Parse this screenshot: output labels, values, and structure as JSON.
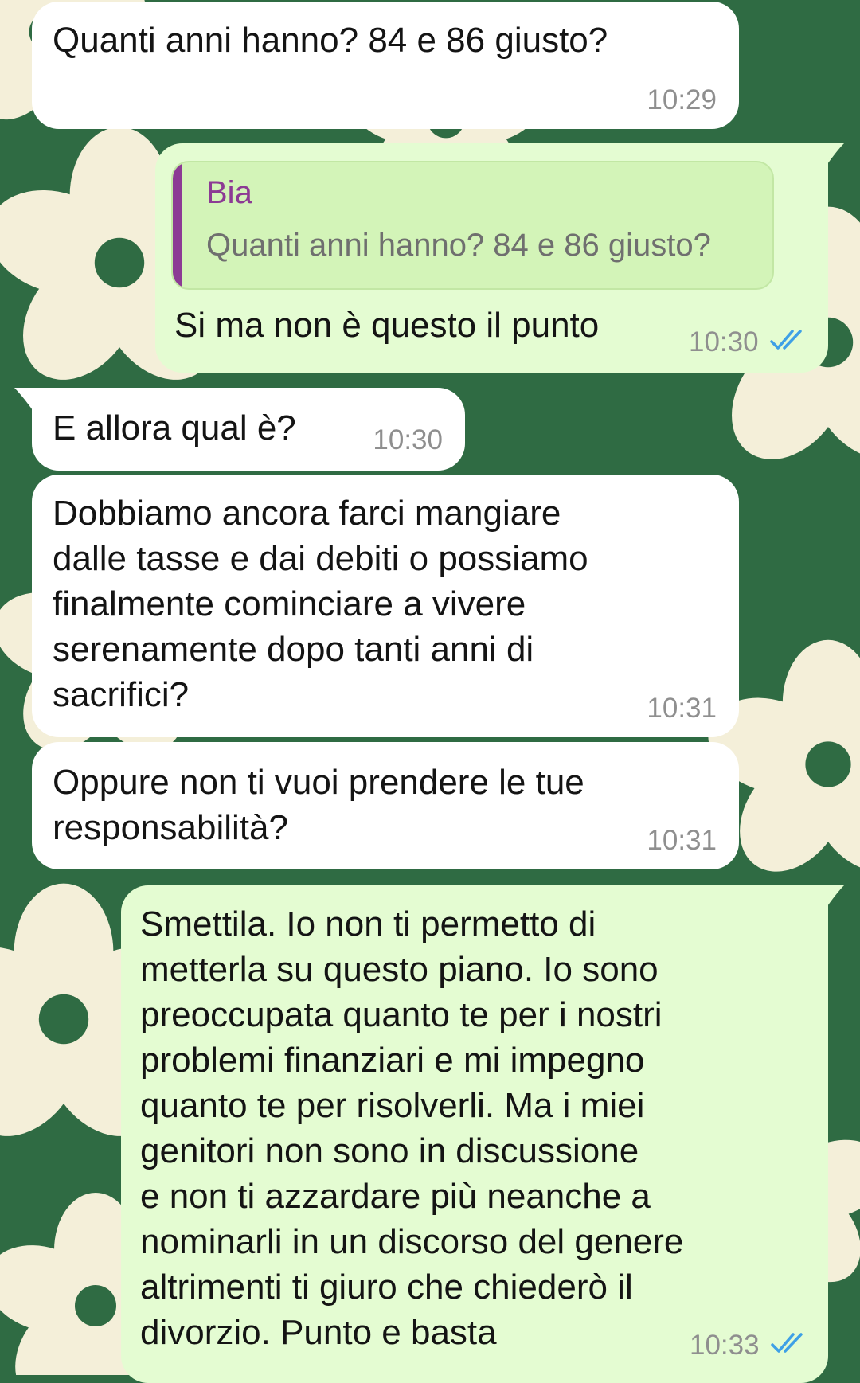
{
  "colors": {
    "wallpaper": "#2f6b43",
    "flower": "#f4efd9",
    "incoming_bubble": "#ffffff",
    "outgoing_bubble": "#e4fcd2",
    "quote_accent": "#8c3a94",
    "read_ticks": "#3ea0e6"
  },
  "icons": {
    "read_receipt": "double-check-icon"
  },
  "messages": [
    {
      "direction": "incoming",
      "text": "Quanti anni hanno? 84 e 86 giusto?",
      "time": "10:29"
    },
    {
      "direction": "outgoing",
      "reply": {
        "author": "Bia",
        "text": "Quanti anni hanno? 84 e 86 giusto?"
      },
      "text": "Si ma non è questo il punto",
      "time": "10:30",
      "status": "read"
    },
    {
      "direction": "incoming",
      "text": "E allora qual è?",
      "time": "10:30"
    },
    {
      "direction": "incoming",
      "text": "Dobbiamo ancora farci mangiare\ndalle tasse e dai debiti o possiamo\nfinalmente cominciare a vivere\nserenamente dopo tanti anni di\nsacrifici?",
      "time": "10:31"
    },
    {
      "direction": "incoming",
      "text": "Oppure non ti vuoi prendere le tue\nresponsabilità?",
      "time": "10:31"
    },
    {
      "direction": "outgoing",
      "text": "Smettila. Io non ti permetto di\nmetterla su questo piano. Io sono\npreoccupata quanto te per i nostri\nproblemi finanziari e mi impegno\nquanto te per risolverli. Ma i miei\ngenitori non sono in discussione\ne non ti azzardare più neanche a\nnominarli in un discorso del genere\naltrimenti ti giuro che chiederò il\ndivorzio. Punto e basta",
      "time": "10:33",
      "status": "read"
    }
  ]
}
